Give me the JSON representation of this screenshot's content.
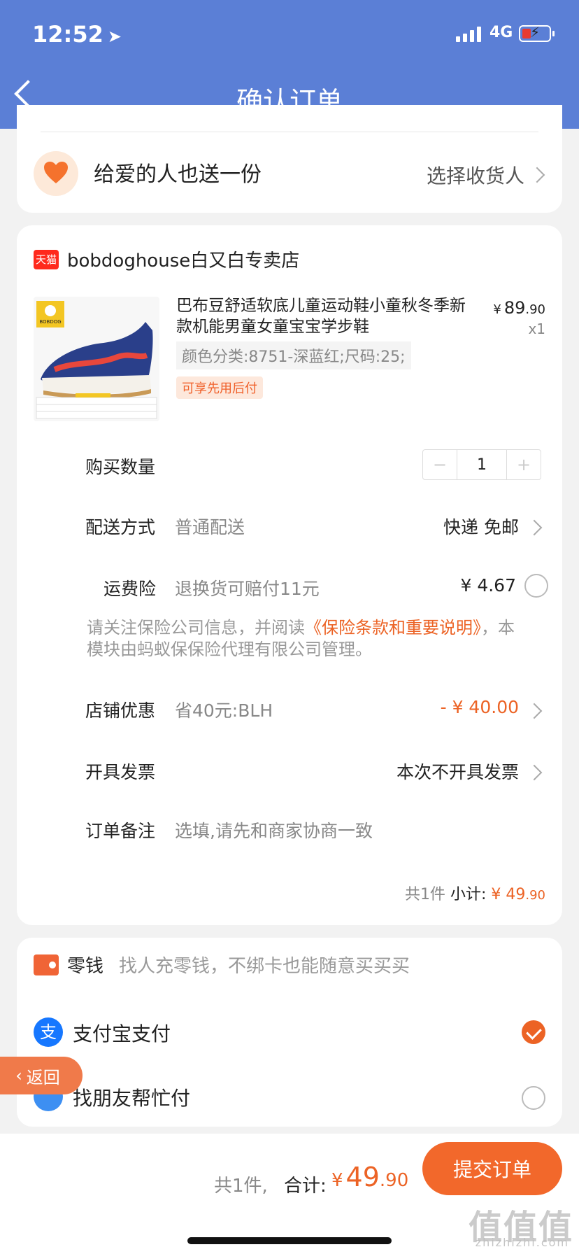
{
  "status_bar": {
    "time": "12:52",
    "network": "4G"
  },
  "header": {
    "title": "确认订单"
  },
  "gift": {
    "text": "给爱的人也送一份",
    "action": "选择收货人"
  },
  "store": {
    "badge": "天猫",
    "name": "bobdoghouse白又白专卖店"
  },
  "product": {
    "title": "巴布豆舒适软底儿童运动鞋小童秋冬季新款机能男童女童宝宝学步鞋",
    "sku": "颜色分类:8751-深蓝红;尺码:25;",
    "tag": "可享先用后付",
    "price_currency": "¥",
    "price_int": "89",
    "price_dec": ".90",
    "quantity": "x1",
    "image_brand": "BOBDOG"
  },
  "order": {
    "qty_label": "购买数量",
    "qty_value": "1",
    "minus": "−",
    "plus": "+",
    "delivery_label": "配送方式",
    "delivery_value": "普通配送",
    "delivery_right": "快递 免邮",
    "insurance_label": "运费险",
    "insurance_value": "退换货可赔付11元",
    "insurance_price": "¥ 4.67",
    "insurance_note_pre": "请关注保险公司信息，并阅读",
    "insurance_note_link": "《保险条款和重要说明》",
    "insurance_note_post": "，本模块由蚂蚁保保险代理有限公司管理。",
    "discount_label": "店铺优惠",
    "discount_value": "省40元:BLH",
    "discount_right": "- ¥ 40.00",
    "invoice_label": "开具发票",
    "invoice_right": "本次不开具发票",
    "remark_label": "订单备注",
    "remark_placeholder": "选填,请先和商家协商一致",
    "subtotal_count": "共1件",
    "subtotal_label": "小计:",
    "subtotal_currency": "¥",
    "subtotal_int": "49",
    "subtotal_dec": ".90"
  },
  "payment": {
    "wallet_label": "零钱",
    "wallet_note": "找人充零钱，不绑卡也能随意买买买",
    "alipay_icon": "支",
    "alipay_label": "支付宝支付",
    "friend_label": "找朋友帮忙付"
  },
  "float_back": {
    "label": "返回"
  },
  "bottom": {
    "count": "共1件,",
    "total_label": "合计:",
    "total_currency": "¥",
    "total_int": "49",
    "total_dec": ".90",
    "submit": "提交订单",
    "watermark": "值值值",
    "watermark_sub": "zhizhizhi.com"
  }
}
